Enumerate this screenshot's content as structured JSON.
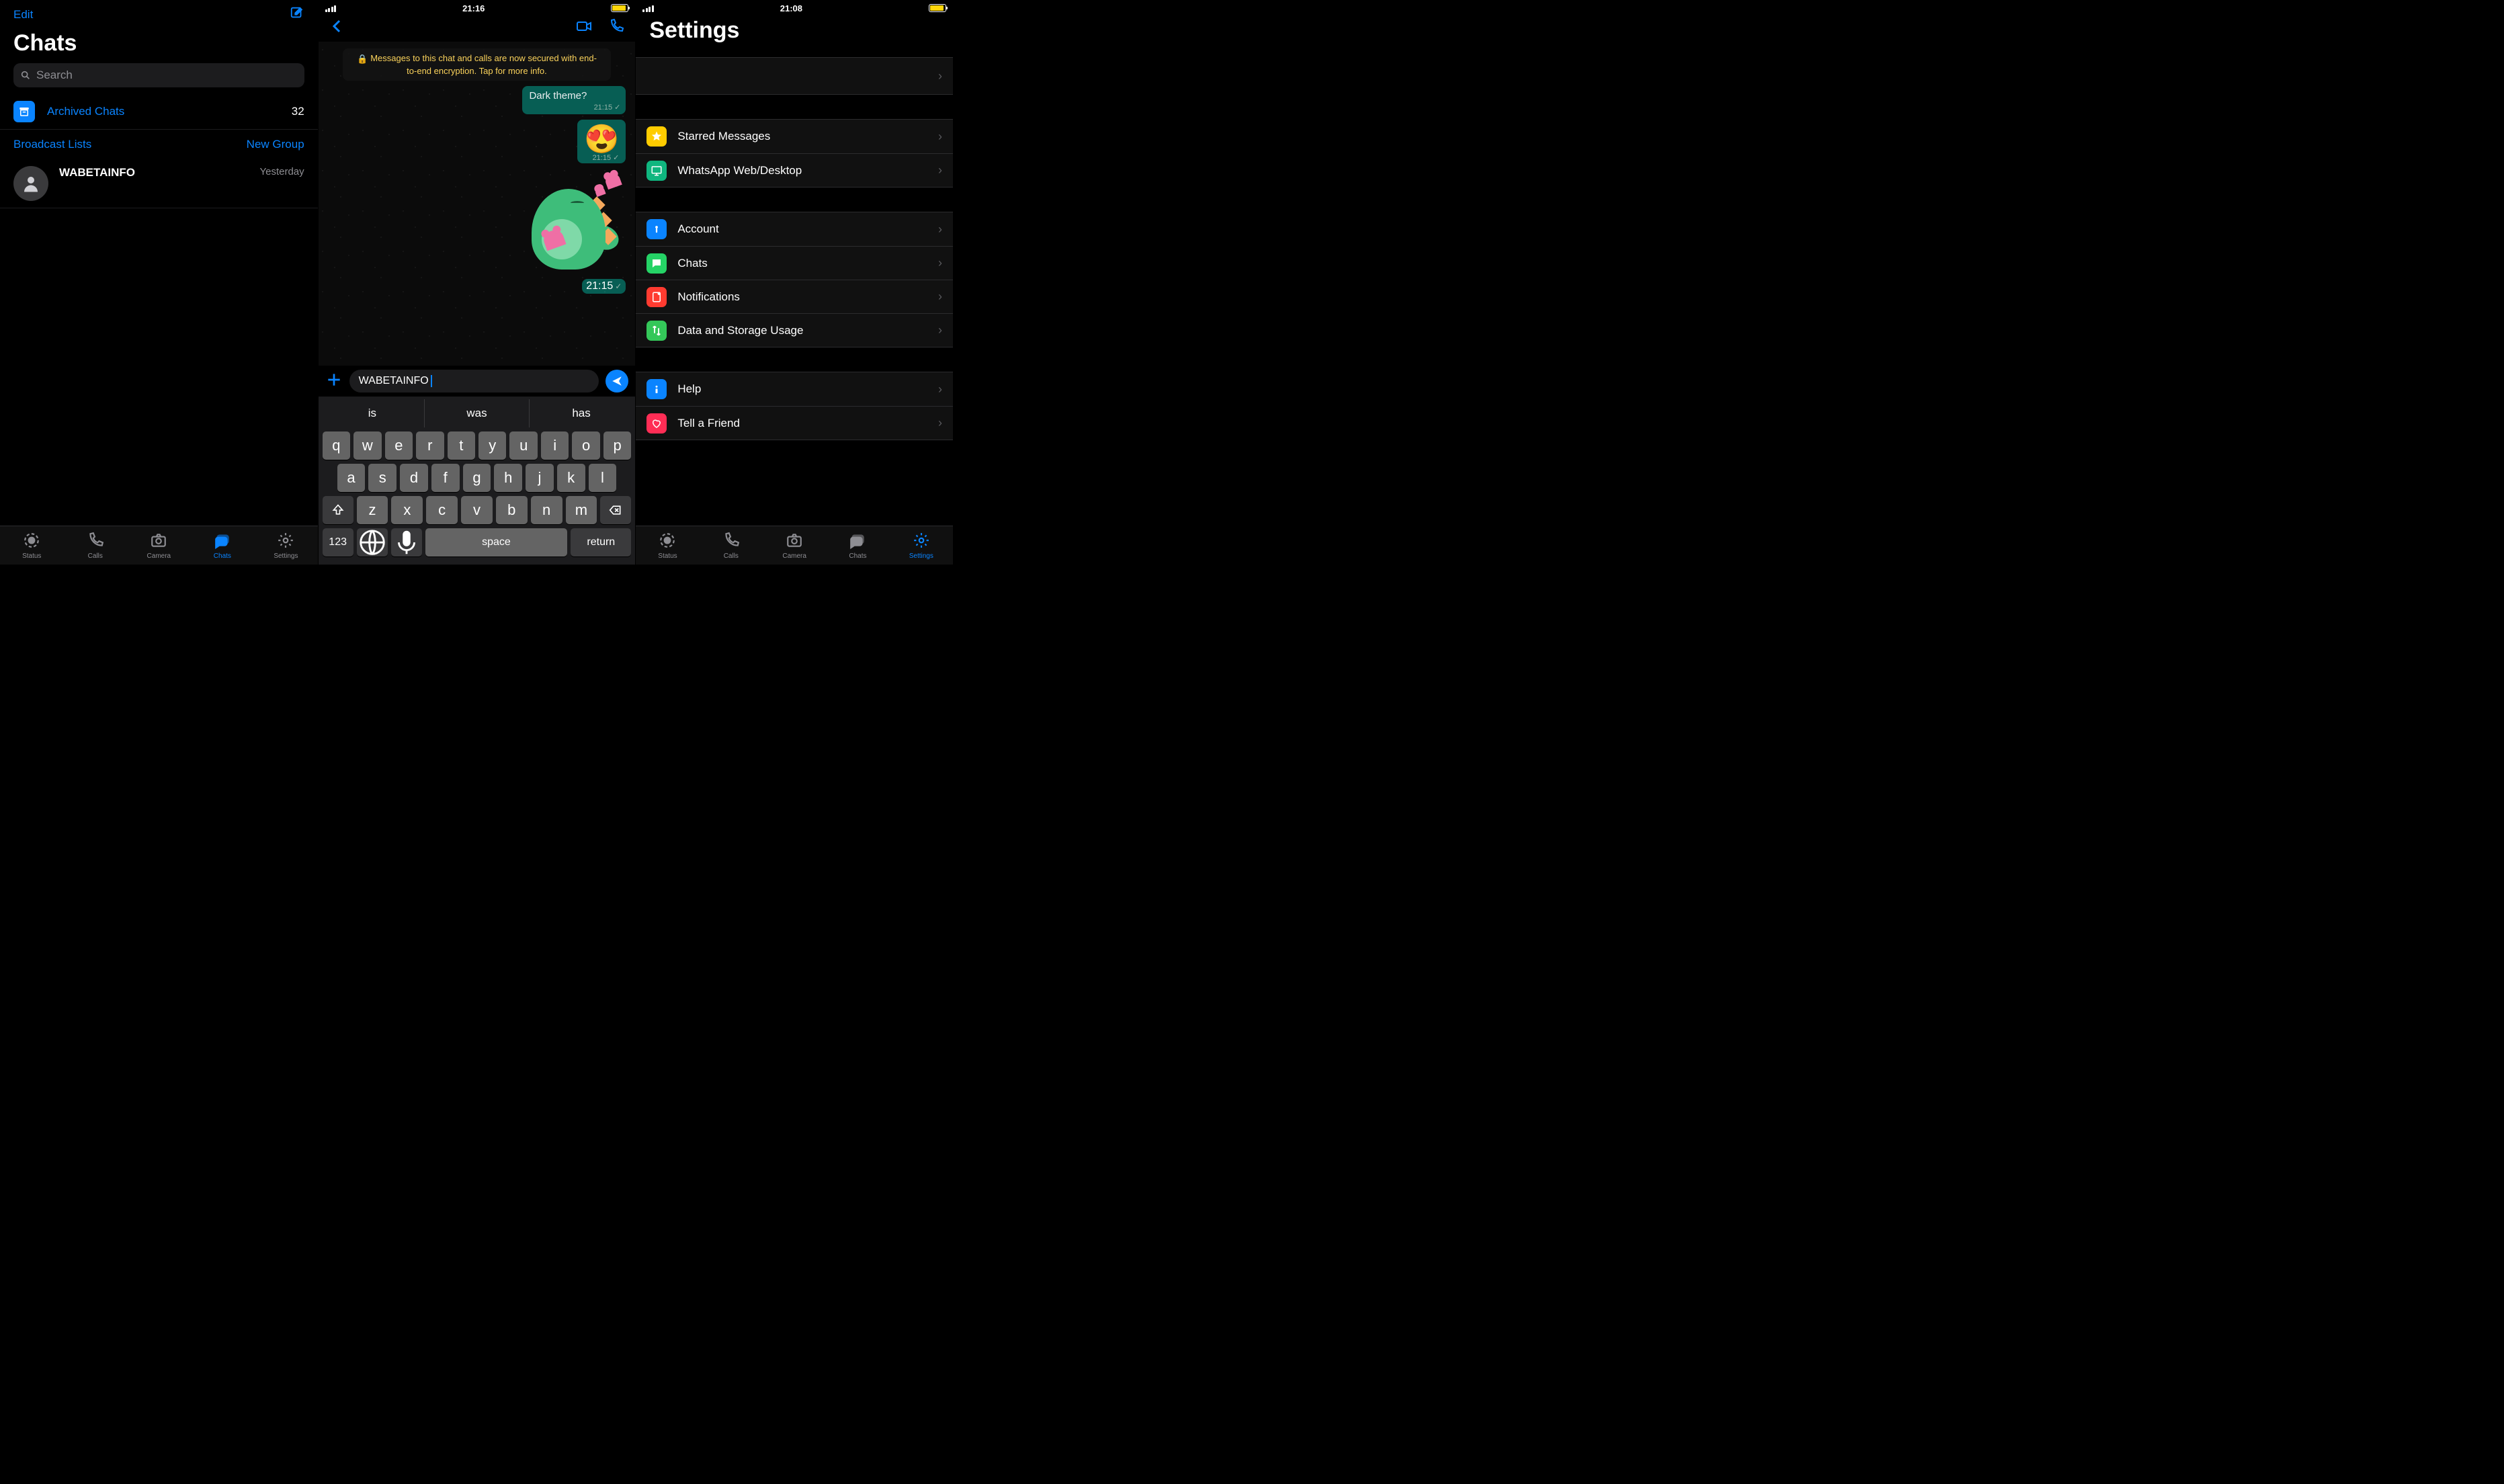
{
  "pane1": {
    "edit": "Edit",
    "title": "Chats",
    "search_placeholder": "Search",
    "archived_label": "Archived Chats",
    "archived_count": "32",
    "broadcast": "Broadcast Lists",
    "new_group": "New Group",
    "chat": {
      "name": "WABETAINFO",
      "time": "Yesterday"
    },
    "tabs": [
      "Status",
      "Calls",
      "Camera",
      "Chats",
      "Settings"
    ],
    "active_tab": "Chats"
  },
  "pane2": {
    "status_time": "21:16",
    "encryption_notice": "Messages to this chat and calls are now secured with end-to-end encryption. Tap for more info.",
    "msg1": {
      "text": "Dark theme?",
      "time": "21:15"
    },
    "msg2": {
      "emoji": "😍",
      "time": "21:15"
    },
    "sticker_time": "21:15",
    "input_value": "WABETAINFO",
    "predictions": [
      "is",
      "was",
      "has"
    ],
    "keys_r1": [
      "q",
      "w",
      "e",
      "r",
      "t",
      "y",
      "u",
      "i",
      "o",
      "p"
    ],
    "keys_r2": [
      "a",
      "s",
      "d",
      "f",
      "g",
      "h",
      "j",
      "k",
      "l"
    ],
    "keys_r3": [
      "z",
      "x",
      "c",
      "v",
      "b",
      "n",
      "m"
    ],
    "key_123": "123",
    "key_space": "space",
    "key_return": "return"
  },
  "pane3": {
    "status_time": "21:08",
    "title": "Settings",
    "group1": [
      {
        "label": "Starred Messages",
        "icon": "star"
      },
      {
        "label": "WhatsApp Web/Desktop",
        "icon": "web"
      }
    ],
    "group2": [
      {
        "label": "Account",
        "icon": "acct"
      },
      {
        "label": "Chats",
        "icon": "chat"
      },
      {
        "label": "Notifications",
        "icon": "notif"
      },
      {
        "label": "Data and Storage Usage",
        "icon": "data"
      }
    ],
    "group3": [
      {
        "label": "Help",
        "icon": "help"
      },
      {
        "label": "Tell a Friend",
        "icon": "tell"
      }
    ],
    "tabs": [
      "Status",
      "Calls",
      "Camera",
      "Chats",
      "Settings"
    ],
    "active_tab": "Settings"
  }
}
